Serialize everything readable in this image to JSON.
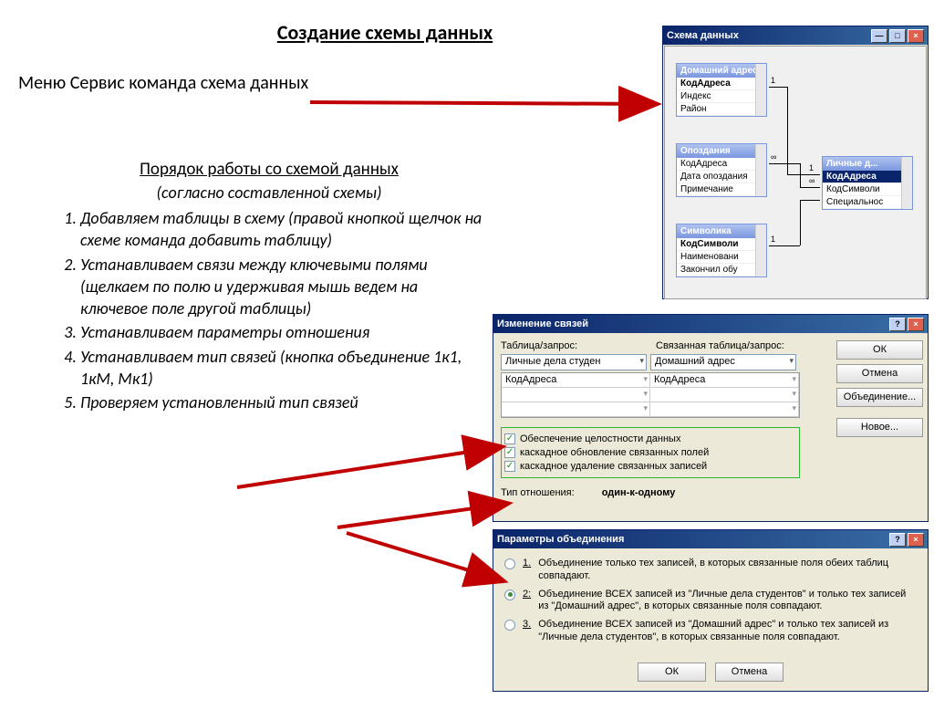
{
  "title": "Создание схемы данных",
  "menu_line": "Меню Сервис команда схема данных",
  "steps": {
    "heading": "Порядок работы со схемой данных",
    "sub": "(согласно составленной схемы)",
    "items": [
      "Добавляем таблицы в схему (правой кнопкой щелчок на схеме команда добавить таблицу)",
      "Устанавливаем связи между ключевыми полями (щелкаем по полю и удерживая мышь ведем на ключевое поле другой таблицы)",
      "Устанавливаем параметры отношения",
      "Устанавливаем тип связей (кнопка объединение 1к1, 1кМ, Мк1)",
      "Проверяем установленный тип связей"
    ]
  },
  "schema_win": {
    "title": "Схема данных",
    "tables": {
      "t1": {
        "header": "Домашний адрес",
        "fields": [
          "КодАдреса",
          "Индекс",
          "Район"
        ]
      },
      "t2": {
        "header": "Опоздания",
        "fields": [
          "КодАдреса",
          "Дата опоздания",
          "Примечание"
        ]
      },
      "t3": {
        "header": "Символика",
        "fields": [
          "КодСимволи",
          "Наименовани",
          "Закончил обу"
        ]
      },
      "t4": {
        "header": "Личные д...",
        "fields": [
          "КодАдреса",
          "КодСимволи",
          "Специальнос"
        ]
      }
    },
    "rel_labels": {
      "inf": "∞",
      "one": "1"
    }
  },
  "relations": {
    "title": "Изменение связей",
    "lbl_table": "Таблица/запрос:",
    "lbl_related": "Связанная таблица/запрос:",
    "combo1": "Личные дела студен",
    "combo2": "Домашний адрес",
    "cell1": "КодАдреса",
    "cell2": "КодАдреса",
    "chk1": "Обеспечение целостности данных",
    "chk2": "каскадное обновление связанных полей",
    "chk3": "каскадное удаление связанных записей",
    "lbl_type": "Тип отношения:",
    "type_value": "один-к-одному",
    "btn_ok": "ОК",
    "btn_cancel": "Отмена",
    "btn_join": "Объединение...",
    "btn_new": "Новое..."
  },
  "join": {
    "title": "Параметры объединения",
    "opt1_num": "1.",
    "opt1": "Объединение только тех записей, в которых связанные поля обеих таблиц совпадают.",
    "opt2_num": "2:",
    "opt2": "Объединение ВСЕХ записей из \"Личные дела студентов\" и только тех записей из \"Домашний адрес\", в которых связанные поля совпадают.",
    "opt3_num": "3.",
    "opt3": "Объединение ВСЕХ записей из \"Домашний адрес\" и только тех записей из \"Личные дела студентов\", в которых связанные поля совпадают.",
    "btn_ok": "ОК",
    "btn_cancel": "Отмена"
  }
}
